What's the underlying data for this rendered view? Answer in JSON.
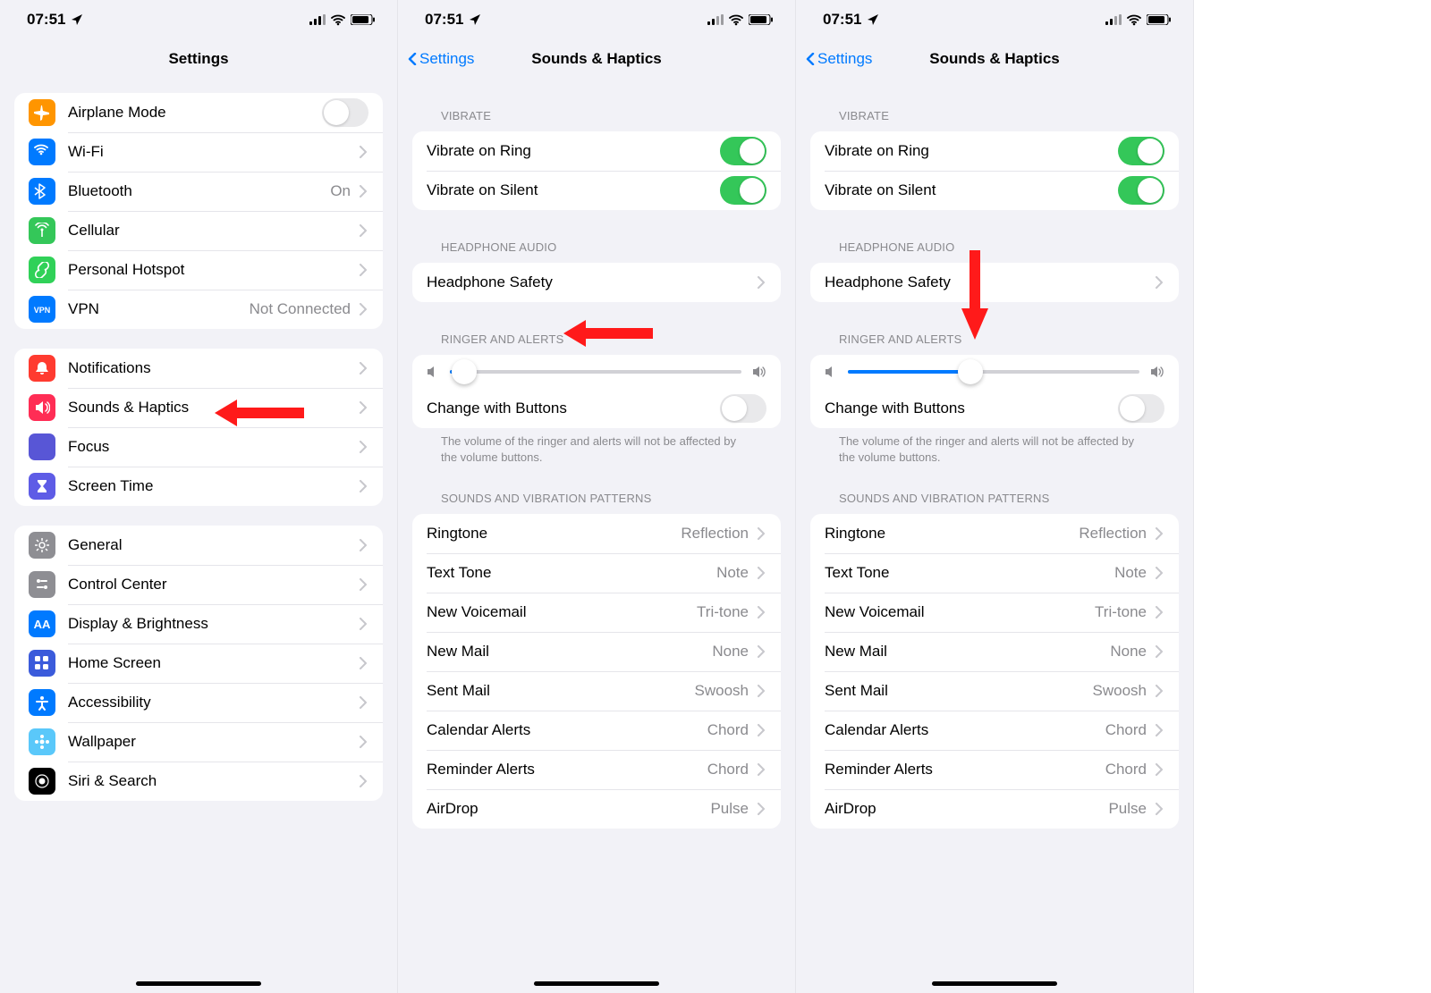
{
  "status": {
    "time": "07:51"
  },
  "settings": {
    "title": "Settings",
    "group1": [
      {
        "id": "airplane",
        "label": "Airplane Mode",
        "type": "toggle",
        "on": false,
        "iconClass": "ic-orange",
        "icon": "airplane"
      },
      {
        "id": "wifi",
        "label": "Wi-Fi",
        "type": "link",
        "detail": "",
        "iconClass": "ic-blue",
        "icon": "wifi"
      },
      {
        "id": "bluetooth",
        "label": "Bluetooth",
        "type": "link",
        "detail": "On",
        "iconClass": "ic-blue",
        "icon": "bluetooth"
      },
      {
        "id": "cellular",
        "label": "Cellular",
        "type": "link",
        "detail": "",
        "iconClass": "ic-green",
        "icon": "antenna"
      },
      {
        "id": "hotspot",
        "label": "Personal Hotspot",
        "type": "link",
        "detail": "",
        "iconClass": "ic-green2",
        "icon": "link"
      },
      {
        "id": "vpn",
        "label": "VPN",
        "type": "link",
        "detail": "Not Connected",
        "iconClass": "ic-vpn",
        "icon": "vpn"
      }
    ],
    "group2": [
      {
        "id": "notifications",
        "label": "Notifications",
        "iconClass": "ic-red",
        "icon": "bell"
      },
      {
        "id": "sounds",
        "label": "Sounds & Haptics",
        "iconClass": "ic-red2",
        "icon": "speaker"
      },
      {
        "id": "focus",
        "label": "Focus",
        "iconClass": "ic-purple",
        "icon": "moon"
      },
      {
        "id": "screentime",
        "label": "Screen Time",
        "iconClass": "ic-indigo",
        "icon": "hourglass"
      }
    ],
    "group3": [
      {
        "id": "general",
        "label": "General",
        "iconClass": "ic-gray",
        "icon": "gear"
      },
      {
        "id": "controlcenter",
        "label": "Control Center",
        "iconClass": "ic-gray2",
        "icon": "switches"
      },
      {
        "id": "display",
        "label": "Display & Brightness",
        "iconClass": "ic-blue",
        "icon": "aa"
      },
      {
        "id": "homescreen",
        "label": "Home Screen",
        "iconClass": "ic-homes",
        "icon": "grid"
      },
      {
        "id": "accessibility",
        "label": "Accessibility",
        "iconClass": "ic-blue2",
        "icon": "access"
      },
      {
        "id": "wallpaper",
        "label": "Wallpaper",
        "iconClass": "ic-ltblue",
        "icon": "flower"
      },
      {
        "id": "siri",
        "label": "Siri & Search",
        "iconClass": "ic-black",
        "icon": "siri"
      }
    ]
  },
  "sounds": {
    "back": "Settings",
    "title": "Sounds & Haptics",
    "section_vibrate": "Vibrate",
    "vibrate_ring": {
      "label": "Vibrate on Ring",
      "on": true
    },
    "vibrate_silent": {
      "label": "Vibrate on Silent",
      "on": true
    },
    "section_headphone": "Headphone Audio",
    "headphone_safety": "Headphone Safety",
    "section_ringer": "Ringer and Alerts",
    "change_buttons": {
      "label": "Change with Buttons",
      "on": false
    },
    "footer": "The volume of the ringer and alerts will not be affected by the volume buttons.",
    "section_patterns": "Sounds and Vibration Patterns",
    "patterns": [
      {
        "label": "Ringtone",
        "detail": "Reflection"
      },
      {
        "label": "Text Tone",
        "detail": "Note"
      },
      {
        "label": "New Voicemail",
        "detail": "Tri-tone"
      },
      {
        "label": "New Mail",
        "detail": "None"
      },
      {
        "label": "Sent Mail",
        "detail": "Swoosh"
      },
      {
        "label": "Calendar Alerts",
        "detail": "Chord"
      },
      {
        "label": "Reminder Alerts",
        "detail": "Chord"
      },
      {
        "label": "AirDrop",
        "detail": "Pulse"
      }
    ]
  },
  "phone2": {
    "slider": 5
  },
  "phone3": {
    "slider": 42
  },
  "annotations": {
    "arrow1": "points-left",
    "arrow2": "points-left",
    "arrow3": "points-down"
  }
}
